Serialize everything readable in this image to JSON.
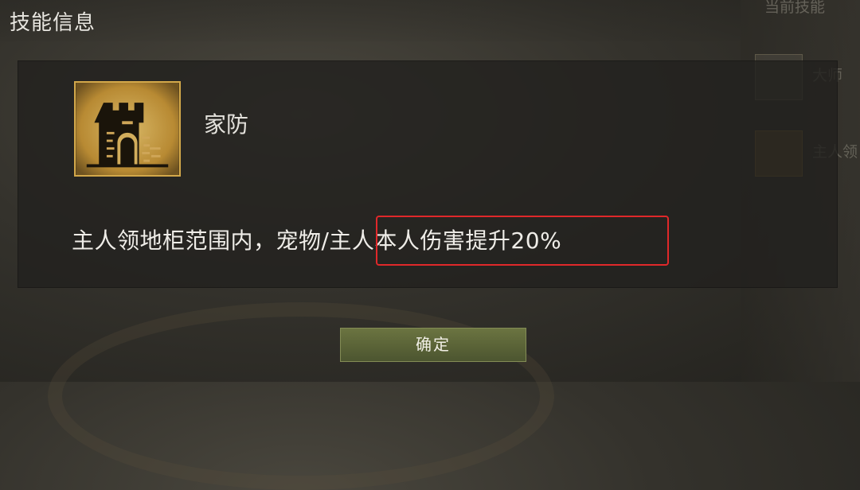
{
  "dialog": {
    "title": "技能信息",
    "skill": {
      "name": "家防",
      "icon": "castle-tower-icon",
      "description": "主人领地柜范围内，宠物/主人本人伤害提升20%"
    },
    "confirm_label": "确定"
  },
  "background": {
    "header_text": "当前技能",
    "rows": [
      {
        "icon": "gears-icon",
        "text": "大师"
      },
      {
        "icon": "castle-tower-icon",
        "text": "主人领"
      }
    ]
  },
  "colors": {
    "icon_gold": "#d3a84a",
    "highlight_red": "#e0282a",
    "button_green": "#5a6337"
  }
}
